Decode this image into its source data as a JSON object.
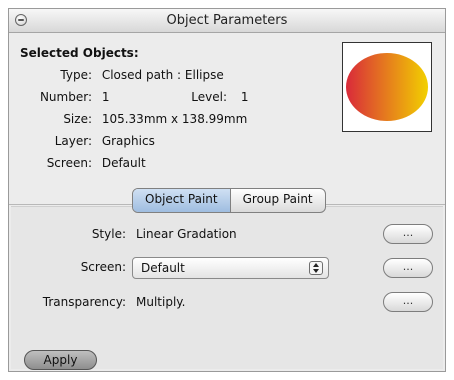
{
  "window": {
    "title": "Object Parameters"
  },
  "selected": {
    "heading": "Selected Objects:",
    "type_label": "Type:",
    "type_value": "Closed path : Ellipse",
    "number_label": "Number:",
    "number_value": "1",
    "level_label": "Level:",
    "level_value": "1",
    "size_label": "Size:",
    "size_value": "105.33mm x 138.99mm",
    "layer_label": "Layer:",
    "layer_value": "Graphics",
    "screen_label": "Screen:",
    "screen_value": "Default"
  },
  "preview": {
    "gradient_start": "#d92a3a",
    "gradient_end": "#f2d000"
  },
  "tabs": [
    "Object Paint",
    "Group Paint"
  ],
  "paint": {
    "style_label": "Style:",
    "style_value": "Linear Gradation",
    "screen_label": "Screen:",
    "screen_selected": "Default",
    "transparency_label": "Transparency:",
    "transparency_value": "Multiply.",
    "more_button_label": "..."
  },
  "apply_label": "Apply"
}
